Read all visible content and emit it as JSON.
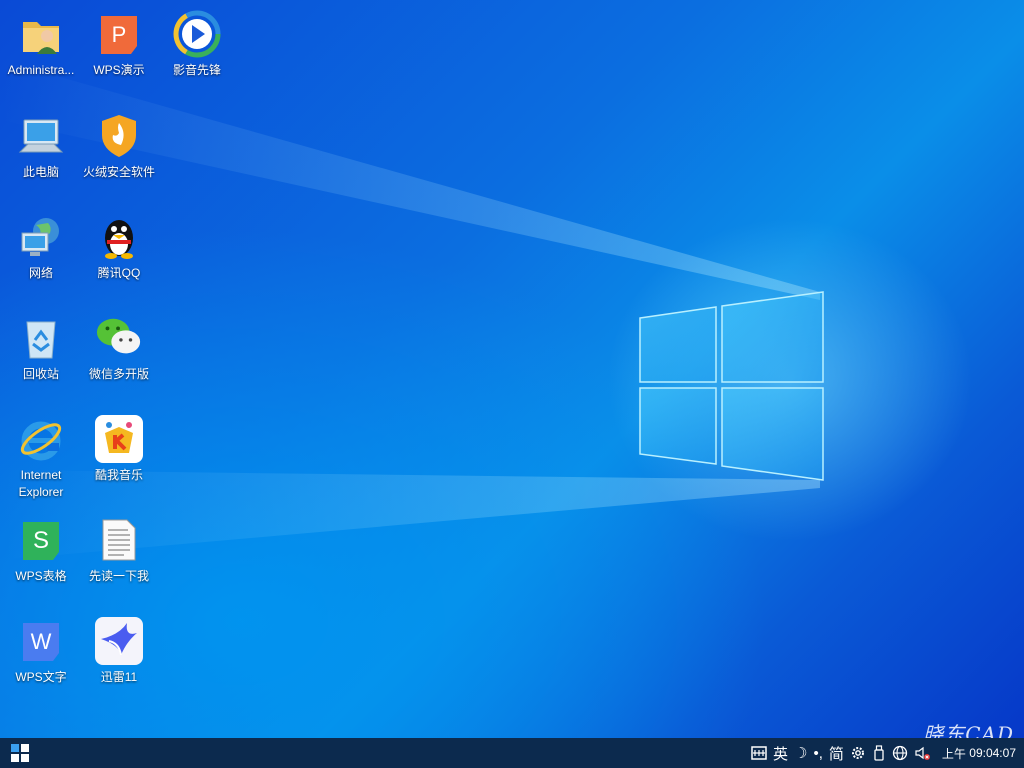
{
  "desktop": {
    "icons": [
      {
        "label": "Administra..."
      },
      {
        "label": "WPS演示"
      },
      {
        "label": "影音先锋"
      },
      {
        "label": "此电脑"
      },
      {
        "label": "火绒安全软件"
      },
      {
        "label": "网络"
      },
      {
        "label": "腾讯QQ"
      },
      {
        "label": "回收站"
      },
      {
        "label": "微信多开版"
      },
      {
        "label": "Internet Explorer"
      },
      {
        "label": "酷我音乐"
      },
      {
        "label": "WPS表格"
      },
      {
        "label": "先读一下我"
      },
      {
        "label": "WPS文字"
      },
      {
        "label": "迅雷11"
      }
    ]
  },
  "taskbar": {
    "ime_lang": "英",
    "ime_moon": "☽",
    "ime_punct": "•,",
    "ime_simplified": "简",
    "clock_prefix": "上午",
    "time": "09:04:07"
  },
  "watermark": "晓东CAD",
  "colors": {
    "taskbar": "#0c2a4e",
    "desktop_accent": "#0a6ee0"
  }
}
